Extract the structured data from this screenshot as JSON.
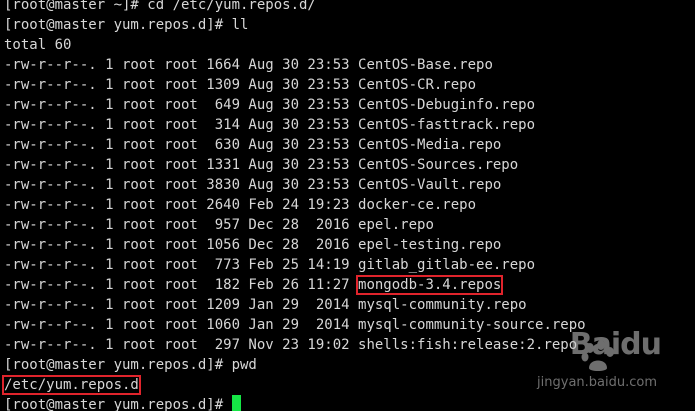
{
  "terminal": {
    "top_partial": "[root@master ~]# cd /etc/yum.repos.d/",
    "prompt1": "[root@master yum.repos.d]# ll",
    "total": "total 60",
    "files": [
      {
        "perms": "-rw-r--r--.",
        "links": "1",
        "owner": "root",
        "group": "root",
        "size": "1664",
        "month": "Aug",
        "day": "30",
        "time": "23:53",
        "name": "CentOS-Base.repo"
      },
      {
        "perms": "-rw-r--r--.",
        "links": "1",
        "owner": "root",
        "group": "root",
        "size": "1309",
        "month": "Aug",
        "day": "30",
        "time": "23:53",
        "name": "CentOS-CR.repo"
      },
      {
        "perms": "-rw-r--r--.",
        "links": "1",
        "owner": "root",
        "group": "root",
        "size": "649",
        "month": "Aug",
        "day": "30",
        "time": "23:53",
        "name": "CentOS-Debuginfo.repo"
      },
      {
        "perms": "-rw-r--r--.",
        "links": "1",
        "owner": "root",
        "group": "root",
        "size": "314",
        "month": "Aug",
        "day": "30",
        "time": "23:53",
        "name": "CentOS-fasttrack.repo"
      },
      {
        "perms": "-rw-r--r--.",
        "links": "1",
        "owner": "root",
        "group": "root",
        "size": "630",
        "month": "Aug",
        "day": "30",
        "time": "23:53",
        "name": "CentOS-Media.repo"
      },
      {
        "perms": "-rw-r--r--.",
        "links": "1",
        "owner": "root",
        "group": "root",
        "size": "1331",
        "month": "Aug",
        "day": "30",
        "time": "23:53",
        "name": "CentOS-Sources.repo"
      },
      {
        "perms": "-rw-r--r--.",
        "links": "1",
        "owner": "root",
        "group": "root",
        "size": "3830",
        "month": "Aug",
        "day": "30",
        "time": "23:53",
        "name": "CentOS-Vault.repo"
      },
      {
        "perms": "-rw-r--r--.",
        "links": "1",
        "owner": "root",
        "group": "root",
        "size": "2640",
        "month": "Feb",
        "day": "24",
        "time": "19:23",
        "name": "docker-ce.repo"
      },
      {
        "perms": "-rw-r--r--.",
        "links": "1",
        "owner": "root",
        "group": "root",
        "size": "957",
        "month": "Dec",
        "day": "28",
        "time": "2016",
        "name": "epel.repo"
      },
      {
        "perms": "-rw-r--r--.",
        "links": "1",
        "owner": "root",
        "group": "root",
        "size": "1056",
        "month": "Dec",
        "day": "28",
        "time": "2016",
        "name": "epel-testing.repo"
      },
      {
        "perms": "-rw-r--r--.",
        "links": "1",
        "owner": "root",
        "group": "root",
        "size": "773",
        "month": "Feb",
        "day": "25",
        "time": "14:19",
        "name": "gitlab_gitlab-ee.repo"
      },
      {
        "perms": "-rw-r--r--.",
        "links": "1",
        "owner": "root",
        "group": "root",
        "size": "182",
        "month": "Feb",
        "day": "26",
        "time": "11:27",
        "name": "mongodb-3.4.repos",
        "highlight": true
      },
      {
        "perms": "-rw-r--r--.",
        "links": "1",
        "owner": "root",
        "group": "root",
        "size": "1209",
        "month": "Jan",
        "day": "29",
        "time": "2014",
        "name": "mysql-community.repo"
      },
      {
        "perms": "-rw-r--r--.",
        "links": "1",
        "owner": "root",
        "group": "root",
        "size": "1060",
        "month": "Jan",
        "day": "29",
        "time": "2014",
        "name": "mysql-community-source.repo"
      },
      {
        "perms": "-rw-r--r--.",
        "links": "1",
        "owner": "root",
        "group": "root",
        "size": "297",
        "month": "Nov",
        "day": "23",
        "time": "19:02",
        "name": "shells:fish:release:2.repo"
      }
    ],
    "prompt2": "[root@master yum.repos.d]# pwd",
    "pwd_output": "/etc/yum.repos.d",
    "prompt3": "[root@master yum.repos.d]# ",
    "colors": {
      "background": "#000000",
      "text": "#d7d7d7",
      "cursor": "#15e645",
      "highlight_box": "#e0242c"
    }
  },
  "watermark": {
    "brand": "Baidu",
    "sub": "jingyan.baidu.com"
  }
}
